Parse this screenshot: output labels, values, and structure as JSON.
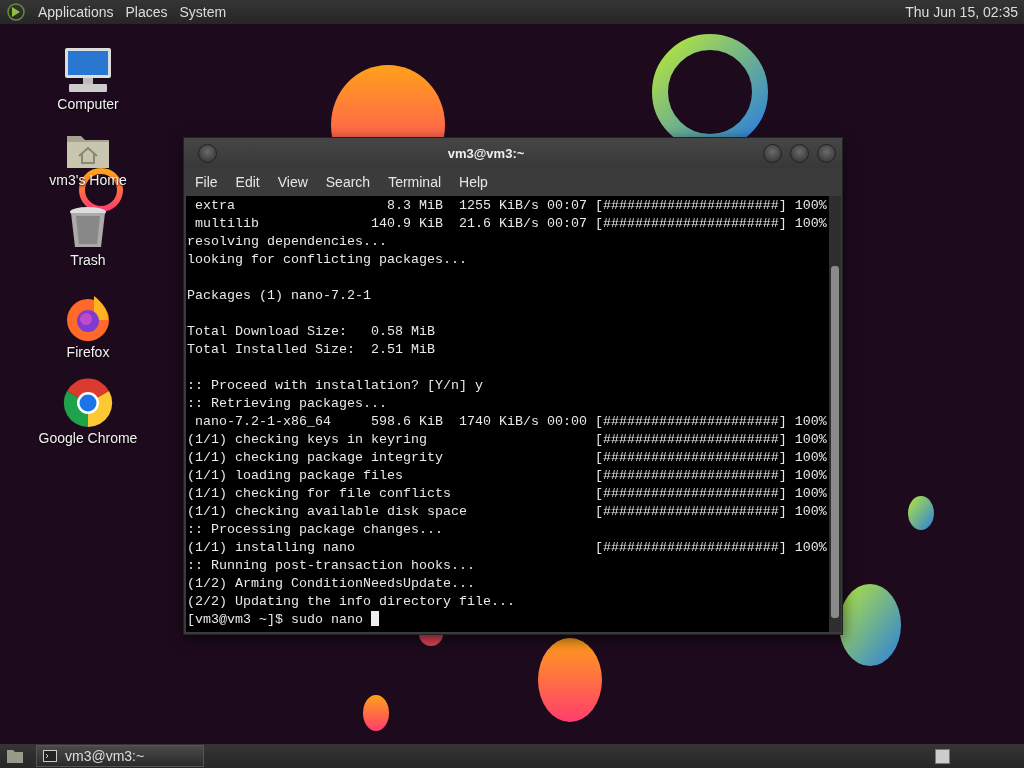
{
  "top_panel": {
    "menus": [
      "Applications",
      "Places",
      "System"
    ],
    "clock": "Thu Jun 15, 02:35"
  },
  "desktop_icons": [
    {
      "label": "Computer",
      "kind": "computer"
    },
    {
      "label": "vm3's Home",
      "kind": "home"
    },
    {
      "label": "Trash",
      "kind": "trash"
    },
    {
      "label": "Firefox",
      "kind": "firefox"
    },
    {
      "label": "Google Chrome",
      "kind": "chrome"
    }
  ],
  "terminal": {
    "title": "vm3@vm3:~",
    "menu": [
      "File",
      "Edit",
      "View",
      "Search",
      "Terminal",
      "Help"
    ],
    "blocks": [
      [
        {
          "kind": "plain",
          "text": " extra                   8.3 MiB  1255 KiB/s 00:07 [######################] 100%"
        },
        {
          "kind": "plain",
          "text": " multilib              140.9 KiB  21.6 KiB/s 00:07 [######################] 100%"
        },
        {
          "kind": "plain",
          "text": "resolving dependencies..."
        },
        {
          "kind": "plain",
          "text": "looking for conflicting packages..."
        }
      ],
      [
        {
          "kind": "plain",
          "text": "Packages (1) nano-7.2-1"
        }
      ],
      [
        {
          "kind": "plain",
          "text": "Total Download Size:   0.58 MiB"
        },
        {
          "kind": "plain",
          "text": "Total Installed Size:  2.51 MiB"
        }
      ],
      [
        {
          "kind": "plain",
          "text": ":: Proceed with installation? [Y/n] y"
        },
        {
          "kind": "plain",
          "text": ":: Retrieving packages..."
        },
        {
          "kind": "plain",
          "text": " nano-7.2-1-x86_64     598.6 KiB  1740 KiB/s 00:00 [######################] 100%"
        },
        {
          "kind": "progress",
          "text": "(1/1) checking keys in keyring",
          "bar": "[######################] 100%"
        },
        {
          "kind": "progress",
          "text": "(1/1) checking package integrity",
          "bar": "[######################] 100%"
        },
        {
          "kind": "progress",
          "text": "(1/1) loading package files",
          "bar": "[######################] 100%"
        },
        {
          "kind": "progress",
          "text": "(1/1) checking for file conflicts",
          "bar": "[######################] 100%"
        },
        {
          "kind": "progress",
          "text": "(1/1) checking available disk space",
          "bar": "[######################] 100%"
        },
        {
          "kind": "plain",
          "text": ":: Processing package changes..."
        },
        {
          "kind": "progress",
          "text": "(1/1) installing nano",
          "bar": "[######################] 100%"
        },
        {
          "kind": "plain",
          "text": ":: Running post-transaction hooks..."
        },
        {
          "kind": "plain",
          "text": "(1/2) Arming ConditionNeedsUpdate..."
        },
        {
          "kind": "plain",
          "text": "(2/2) Updating the info directory file..."
        }
      ]
    ],
    "prompt": "[vm3@vm3 ~]$ sudo nano"
  },
  "taskbar": {
    "tasks": [
      "vm3@vm3:~"
    ]
  }
}
